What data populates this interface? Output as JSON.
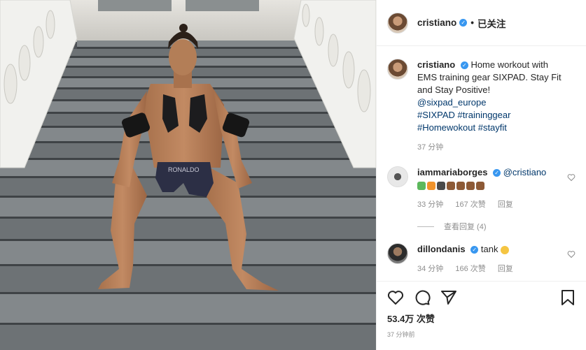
{
  "header": {
    "username": "cristiano",
    "dot": "•",
    "follow_status": "已关注"
  },
  "caption": {
    "username": "cristiano",
    "text": "Home workout with EMS training gear SIXPAD. Stay Fit and Stay Positive!",
    "tags": [
      "@sixpad_europe",
      "#SIXPAD #traininggear",
      "#Homewokout #stayfit"
    ],
    "time": "37 分钟"
  },
  "comments": [
    {
      "username": "iammariaborges",
      "mention": "@cristiano",
      "time": "33 分钟",
      "likes": "167 次赞",
      "reply": "回复",
      "view_replies": "查看回复 (4)"
    },
    {
      "username": "dillondanis",
      "text": "tank",
      "time": "34 分钟",
      "likes": "166 次赞",
      "reply": "回复"
    }
  ],
  "footer": {
    "likes": "53.4万 次赞",
    "time": "37 分钟前"
  },
  "colors": {
    "link": "#00376b",
    "verified": "#3897f0",
    "muted": "#8e8e8e"
  },
  "icons": [
    "heart-icon",
    "comment-icon",
    "share-icon",
    "bookmark-icon",
    "verified-icon"
  ]
}
